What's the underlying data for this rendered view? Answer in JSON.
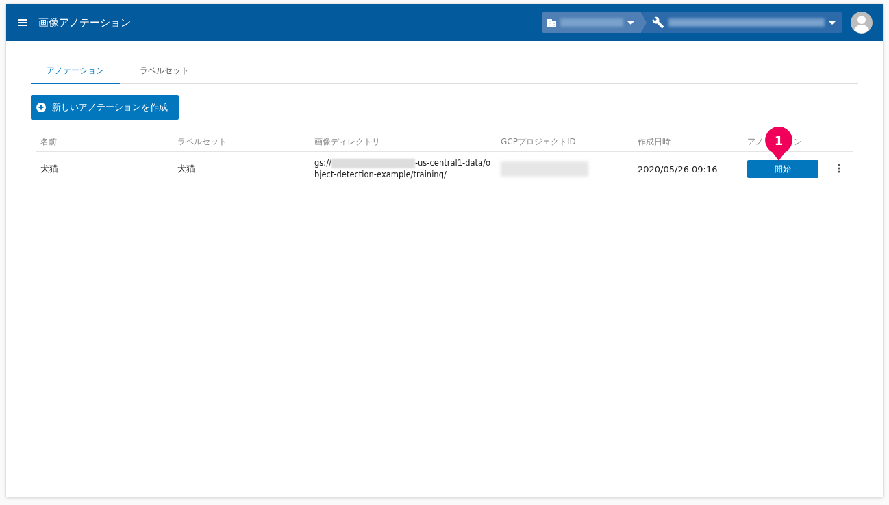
{
  "app_bar": {
    "title": "画像アノテーション"
  },
  "tabs": [
    {
      "label": "アノテーション",
      "selected": true
    },
    {
      "label": "ラベルセット",
      "selected": false
    }
  ],
  "create_button": {
    "label": "新しいアノテーションを作成"
  },
  "table": {
    "columns": [
      {
        "parts": [
          "名前"
        ]
      },
      {
        "parts": [
          "ラベルセット"
        ]
      },
      {
        "parts": [
          "画像ディレクトリ"
        ]
      },
      {
        "parts": [
          "GCPプロジェクトID"
        ]
      },
      {
        "parts": [
          "作成日時"
        ]
      },
      {
        "parts": [
          "アノ",
          "ン"
        ]
      }
    ],
    "rows": [
      {
        "name": "犬猫",
        "label_set": "犬猫",
        "directory_prefix": "gs://",
        "directory_suffix": "-us-central1-data/o",
        "directory_line2": "bject-detection-example/training/",
        "created": "2020/05/26 09:16",
        "action": "開始"
      }
    ]
  },
  "callout": {
    "number": "1"
  }
}
